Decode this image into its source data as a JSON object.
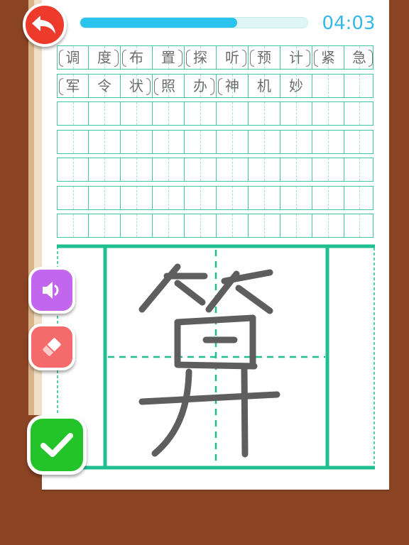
{
  "header": {
    "back_icon": "undo-arrow-icon",
    "progress_fraction": 0.69,
    "timer": "04:03"
  },
  "word_grid": {
    "rows": [
      [
        {
          "char": "调",
          "open": true
        },
        {
          "char": "度",
          "close": true
        },
        {
          "char": "布",
          "open": true
        },
        {
          "char": "置",
          "close": true
        },
        {
          "char": "探",
          "open": true
        },
        {
          "char": "听",
          "close": true
        },
        {
          "char": "预",
          "open": true
        },
        {
          "char": "计",
          "close": true
        },
        {
          "char": "紧",
          "open": true
        },
        {
          "char": "急",
          "close": true
        }
      ],
      [
        {
          "char": "军",
          "open": true
        },
        {
          "char": "令"
        },
        {
          "char": "状",
          "close": true
        },
        {
          "char": "照",
          "open": true
        },
        {
          "char": "办",
          "close": true
        },
        {
          "char": "神",
          "open": true
        },
        {
          "char": "机"
        },
        {
          "char": "妙"
        },
        {
          "char": ""
        },
        {
          "char": ""
        }
      ],
      [
        {
          "char": ""
        },
        {
          "char": ""
        },
        {
          "char": ""
        },
        {
          "char": ""
        },
        {
          "char": ""
        },
        {
          "char": ""
        },
        {
          "char": ""
        },
        {
          "char": ""
        },
        {
          "char": ""
        },
        {
          "char": ""
        }
      ],
      [
        {
          "char": ""
        },
        {
          "char": ""
        },
        {
          "char": ""
        },
        {
          "char": ""
        },
        {
          "char": ""
        },
        {
          "char": ""
        },
        {
          "char": ""
        },
        {
          "char": ""
        },
        {
          "char": ""
        },
        {
          "char": ""
        }
      ],
      [
        {
          "char": ""
        },
        {
          "char": ""
        },
        {
          "char": ""
        },
        {
          "char": ""
        },
        {
          "char": ""
        },
        {
          "char": ""
        },
        {
          "char": ""
        },
        {
          "char": ""
        },
        {
          "char": ""
        },
        {
          "char": ""
        }
      ],
      [
        {
          "char": ""
        },
        {
          "char": ""
        },
        {
          "char": ""
        },
        {
          "char": ""
        },
        {
          "char": ""
        },
        {
          "char": ""
        },
        {
          "char": ""
        },
        {
          "char": ""
        },
        {
          "char": ""
        },
        {
          "char": ""
        }
      ],
      [
        {
          "char": ""
        },
        {
          "char": ""
        },
        {
          "char": ""
        },
        {
          "char": ""
        },
        {
          "char": ""
        },
        {
          "char": ""
        },
        {
          "char": ""
        },
        {
          "char": ""
        },
        {
          "char": ""
        },
        {
          "char": ""
        }
      ]
    ]
  },
  "writing_board": {
    "handwritten_char": "算",
    "grid_color": "#1fbf8f",
    "stroke_color": "#5e5e5e"
  },
  "tools": {
    "sound_icon": "speaker-icon",
    "eraser_icon": "eraser-icon",
    "confirm_icon": "checkmark-icon"
  },
  "colors": {
    "background": "#8a4424",
    "accent_blue": "#2ac3ee",
    "back_red": "#ee3a2a",
    "sound_purple": "#c266ee",
    "eraser_red": "#f56a6a",
    "confirm_green": "#22c42a"
  }
}
